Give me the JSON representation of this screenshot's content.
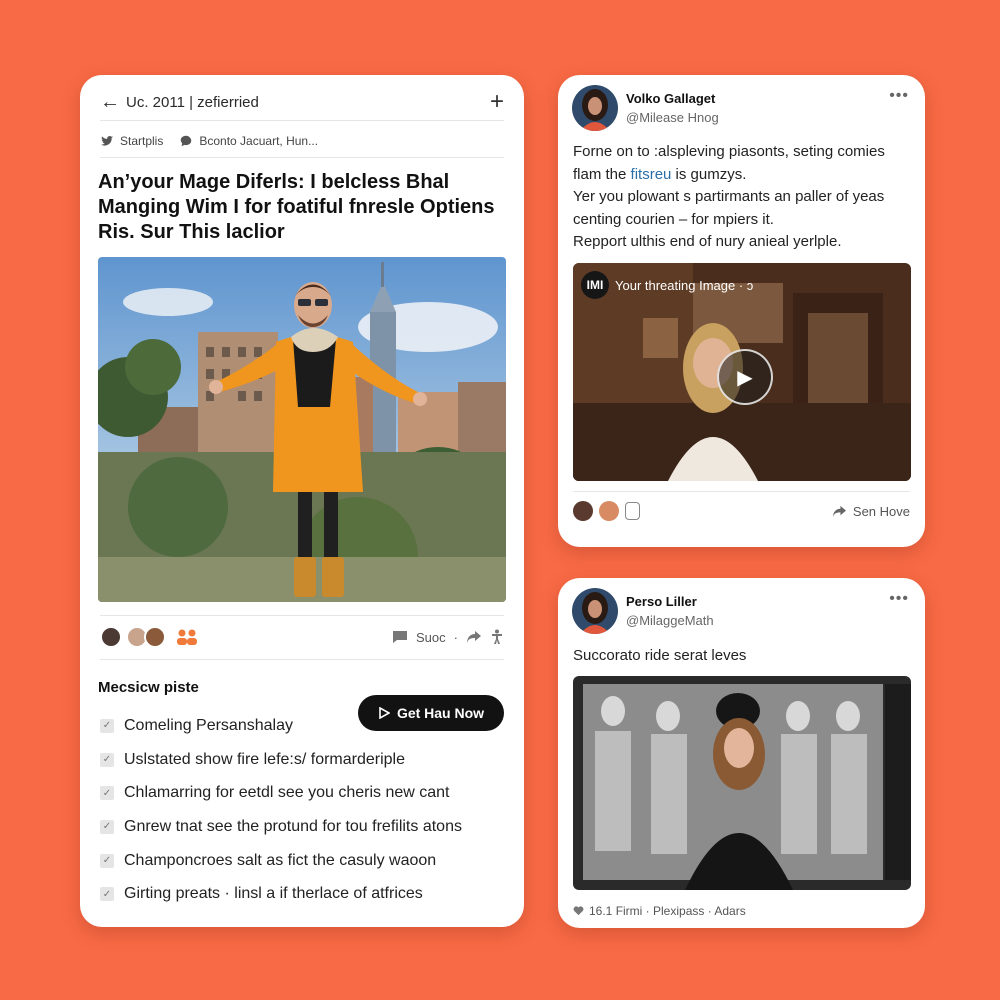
{
  "left_card": {
    "topbar": {
      "back_icon": "arrow-left-icon",
      "title": "Uc. 2011 | zefierried",
      "add_icon": "plus-icon"
    },
    "meta": {
      "item1": "Startplis",
      "item2": "Bconto Jacuart, Hun..."
    },
    "headline": "An’your Mage Diferls: I belcless Bhal Manging Wim I for foatiful fnresle Optiens Ris. Sur This laclior",
    "actions": {
      "comment_label": "Suoc",
      "sep": "·"
    },
    "section_title": "Mecsicw piste",
    "cta_label": "Get Hau Now",
    "checklist": [
      "Comeling Persanshalay",
      "Uslstated show fire lefe:s/ formarderiple",
      "Chlamarring for eetdl see you cheris new cant",
      "Gnrew tnat see the protund for tou frefilits atons",
      "Champoncroes salt as fict the casuly waoon",
      "Girting preats · linsl a if therlace of atfrices"
    ]
  },
  "top_right_card": {
    "name": "Volko Gallaget",
    "handle": "@Milease Hnog",
    "more_icon": "more-dots-icon",
    "text_line1": "Forne on to :alspleving piasonts, seting comies",
    "text_line2_pre": "flam the ",
    "text_line2_link": "fitsreu",
    "text_line2_post": " is gumzys.",
    "text_line3": "Yer you plowant s partirmants an paller of yeas",
    "text_line4": "centing courien – for mpiers it.",
    "text_line5": "Repport ulthis end of nury anieal yerlple.",
    "video_badge": "IMI",
    "video_label": "Your threating Image · ɔ",
    "share_label": "Sen Hove"
  },
  "bottom_right_card": {
    "name": "Perso Liller",
    "handle": "@MilaggeMath",
    "more_icon": "more-dots-icon",
    "text": "Succorato ride serat leves",
    "footer": "16.1 Firmi · Plexipass · Adars"
  },
  "colors": {
    "background": "#f86a45",
    "card": "#ffffff",
    "cta": "#121212",
    "link": "#2b6fa8"
  }
}
